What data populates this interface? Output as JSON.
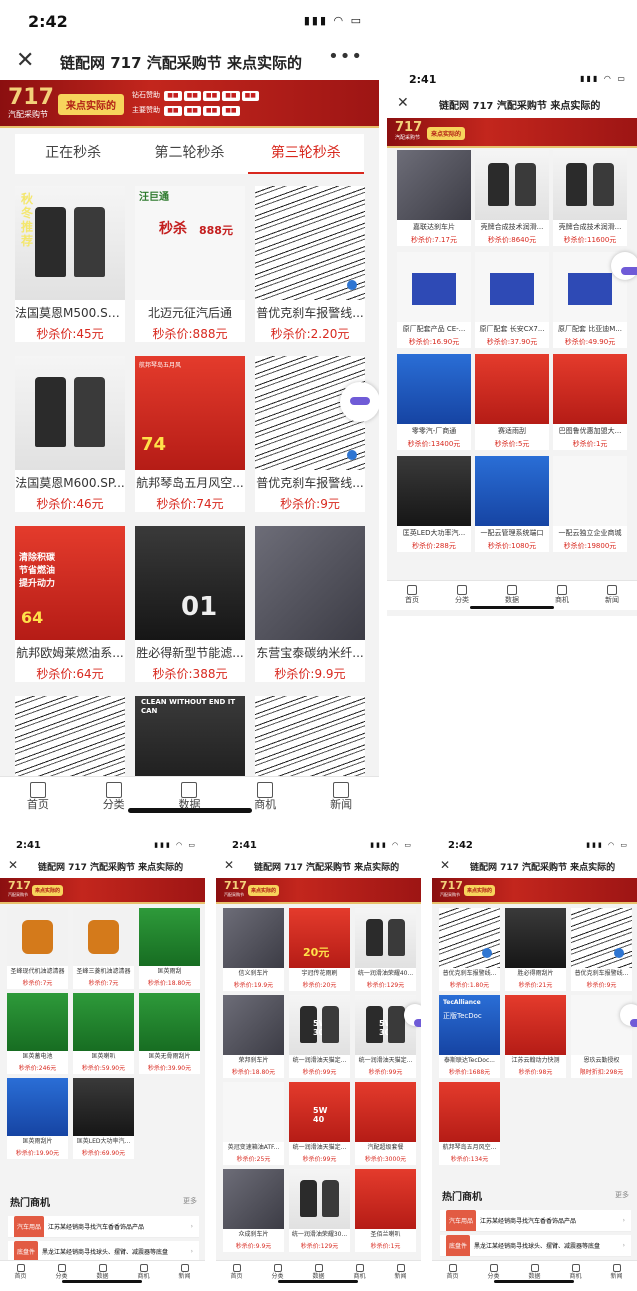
{
  "title": "链配网 717 汽配采购节 来点实际的",
  "logo": {
    "number": "717",
    "caption": "汽配采购节"
  },
  "slogan": "来点实际的",
  "sponsors": {
    "diamond_label": "钻石赞助",
    "main_label": "主要赞助"
  },
  "tabs": [
    "正在秒杀",
    "第二轮秒杀",
    "第三轮秒杀"
  ],
  "bottom_nav": [
    "首页",
    "分类",
    "数据",
    "商机",
    "新闻"
  ],
  "phones": [
    {
      "time": "2:42",
      "products": [
        {
          "name": "法国莫恩M500.SP/...",
          "price": "秒杀价:45元"
        },
        {
          "name": "北迈元征汽后通",
          "price": "秒杀价:888元"
        },
        {
          "name": "普优克刹车报警线...",
          "price": "秒杀价:2.20元"
        },
        {
          "name": "法国莫恩M600.SP...",
          "price": "秒杀价:46元"
        },
        {
          "name": "航邦琴岛五月风空...",
          "price": "秒杀价:74元"
        },
        {
          "name": "普优克刹车报警线...",
          "price": "秒杀价:9元"
        },
        {
          "name": "航邦欧姆莱燃油系...",
          "price": "秒杀价:64元"
        },
        {
          "name": "胜必得新型节能滤...",
          "price": "秒杀价:388元"
        },
        {
          "name": "东营宝泰碳纳米纤...",
          "price": "秒杀价:9.9元"
        },
        {
          "name": "",
          "price": ""
        },
        {
          "name": "",
          "price": ""
        },
        {
          "name": "",
          "price": ""
        }
      ],
      "image_text": {
        "oil_brand": "秋冬推荐",
        "promo_brand": "汪巨通",
        "flash_sale": "秒杀",
        "flash_price": "888元",
        "filter_promo": "航邦琴岛五月风",
        "filter_price": "74",
        "fuel_promo": "清除积碳 节省燃油 提升动力",
        "fuel_price": "64",
        "part_code": "01",
        "wiper_text": "CLEAN WITHOUT END IT CAN"
      }
    },
    {
      "time": "2:41",
      "products": [
        {
          "name": "嘉联达刹车片",
          "price": "秒杀价:7.17元"
        },
        {
          "name": "壳牌合成技术润滑...",
          "price": "秒杀价:8640元"
        },
        {
          "name": "壳牌合成技术润滑...",
          "price": "秒杀价:11600元"
        },
        {
          "name": "原厂配套产品 CE-...",
          "price": "秒杀价:16.90元"
        },
        {
          "name": "原厂配套 长安CX7...",
          "price": "秒杀价:37.90元"
        },
        {
          "name": "原厂配套 比亚迪M...",
          "price": "秒杀价:49.90元"
        },
        {
          "name": "零零汽-厂商通",
          "price": "秒杀价:13400元"
        },
        {
          "name": "赛适雨刮",
          "price": "秒杀价:5元"
        },
        {
          "name": "巴图鲁优惠加盟大...",
          "price": "秒杀价:1元"
        },
        {
          "name": "匡英LED大功率汽...",
          "price": "秒杀价:288元"
        },
        {
          "name": "一配云管理系统端口",
          "price": "秒杀价:1080元"
        },
        {
          "name": "一配云独立企业商城",
          "price": "秒杀价:19800元"
        }
      ]
    },
    {
      "time": "2:41",
      "products": [
        {
          "name": "圣峰现代机油滤清器",
          "price": "秒杀价:7元"
        },
        {
          "name": "圣峰三菱机油滤清器",
          "price": "秒杀价:7元"
        },
        {
          "name": "匡英雨刮",
          "price": "秒杀价:18.80元"
        },
        {
          "name": "匡英蓄电池",
          "price": "秒杀价:246元"
        },
        {
          "name": "匡英喇叭",
          "price": "秒杀价:59.90元"
        },
        {
          "name": "匡英无骨雨刮片",
          "price": "秒杀价:39.90元"
        },
        {
          "name": "匡英雨刮片",
          "price": "秒杀价:19.90元"
        },
        {
          "name": "匡英LED大功率汽...",
          "price": "秒杀价:69.90元"
        }
      ],
      "hot_title": "热门商机",
      "more": "更多",
      "merch": [
        {
          "tag": "汽车用品",
          "text": "江苏某经销商寻找汽车香香饰品产品"
        },
        {
          "tag": "底盘件",
          "text": "黑龙江某经销商寻找球头、摆臂、减震器等底盘"
        }
      ]
    },
    {
      "time": "2:41",
      "products": [
        {
          "name": "信义刹车片",
          "price": "秒杀价:19.9元"
        },
        {
          "name": "宇冠传花雨刷",
          "price": "秒杀价:20元"
        },
        {
          "name": "统一润滑油荣耀40...",
          "price": "秒杀价:129元"
        },
        {
          "name": "荣邦刹车片",
          "price": "秒杀价:18.80元"
        },
        {
          "name": "统一润滑油天猫定...",
          "price": "秒杀价:99元"
        },
        {
          "name": "统一润滑油天猫定...",
          "price": "秒杀价:99元"
        },
        {
          "name": "英冠变速箱油ATF...",
          "price": "秒杀价:25元"
        },
        {
          "name": "统一润滑油天猫定...",
          "price": "秒杀价:99元"
        },
        {
          "name": "汽配超级套餐",
          "price": "秒杀价:3000元"
        },
        {
          "name": "众成刹车片",
          "price": "秒杀价:9.9元"
        },
        {
          "name": "统一润滑油荣耀30...",
          "price": "秒杀价:129元"
        },
        {
          "name": "圣佰兰喇叭",
          "price": "秒杀价:1元"
        }
      ],
      "image_text": {
        "promo_price": "20元",
        "oil_grade_a": "5W 30",
        "oil_grade_b": "5W 30",
        "oil_grade_c": "5W 40"
      }
    },
    {
      "time": "2:42",
      "products": [
        {
          "name": "普优克刹车报警线...",
          "price": "秒杀价:1.80元"
        },
        {
          "name": "胜必得雨刮片",
          "price": "秒杀价:21元"
        },
        {
          "name": "普优克刹车报警线...",
          "price": "秒杀价:9元"
        },
        {
          "name": "泰斯联达TecDoc...",
          "price": "秒杀价:1688元"
        },
        {
          "name": "江苏云翰动力快测",
          "price": "秒杀价:98元"
        },
        {
          "name": "恩玖云勤授权",
          "price": "限时折扣:298元"
        },
        {
          "name": "航邦琴岛五月风空...",
          "price": "秒杀价:134元"
        }
      ],
      "hot_title": "热门商机",
      "more": "更多",
      "merch": [
        {
          "tag": "汽车用品",
          "text": "江苏某经销商寻找汽车香香饰品产品"
        },
        {
          "tag": "底盘件",
          "text": "黑龙江某经销商寻找球头、摆臂、减震器等底盘"
        }
      ],
      "image_text": {
        "tecdoc": "TecAlliance",
        "tecdoc_sub": "正版TecDoc"
      }
    }
  ]
}
